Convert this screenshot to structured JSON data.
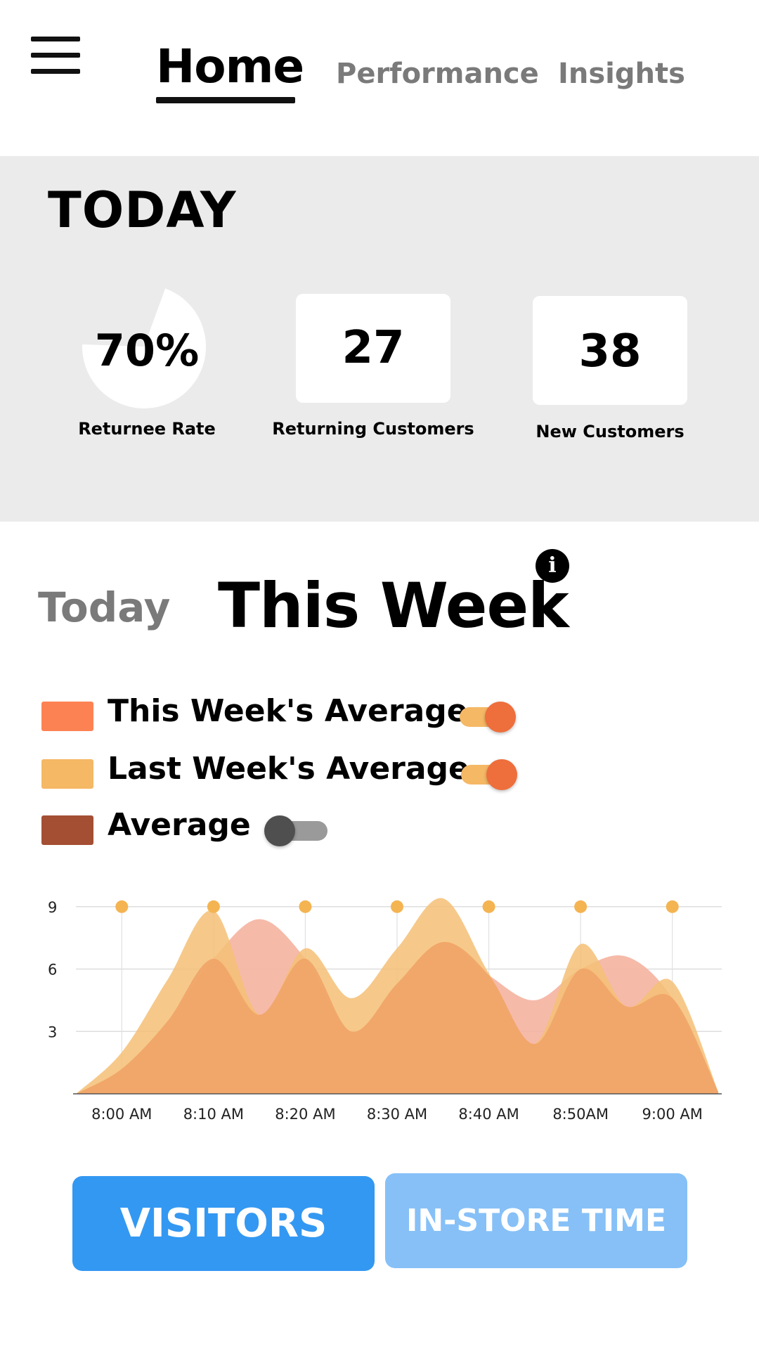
{
  "nav": {
    "tabs": [
      {
        "label": "Home",
        "active": true
      },
      {
        "label": "Performance",
        "active": false
      },
      {
        "label": "Insights",
        "active": false
      }
    ]
  },
  "today": {
    "title": "TODAY",
    "returnee_rate": {
      "value": "70%",
      "fraction": 0.7,
      "label": "Returnee Rate"
    },
    "returning_customers": {
      "value": "27",
      "label": "Returning Customers"
    },
    "new_customers": {
      "value": "38",
      "label": "New Customers"
    }
  },
  "period_tabs": {
    "today": "Today",
    "this_week": "This Week",
    "selected": "This Week"
  },
  "legend": [
    {
      "label": "This Week's Average",
      "color": "#fd8253",
      "toggle_on": true
    },
    {
      "label": "Last Week's Average",
      "color": "#f5b865",
      "toggle_on": true
    },
    {
      "label": "Average",
      "color": "#a44e33",
      "toggle_on": false
    }
  ],
  "colors": {
    "toggle_on_track": "#f5b865",
    "toggle_on_knob": "#ee6e3c",
    "toggle_off_track": "#9a9a9a",
    "toggle_off_knob": "#4f4f4f",
    "this_week_fill": "#f5b3a0",
    "last_week_fill": "#f5c075",
    "overlap_fill": "#f1a467",
    "marker": "#f4b452",
    "visitors_button": "#3398f2",
    "instore_button": "#86c0f7"
  },
  "chart_data": {
    "type": "area",
    "x": [
      "7:55 AM",
      "8:00 AM",
      "8:05 AM",
      "8:10 AM",
      "8:15 AM",
      "8:20 AM",
      "8:25 AM",
      "8:30 AM",
      "8:35 AM",
      "8:40 AM",
      "8:45 AM",
      "8:50AM",
      "8:55 AM",
      "9:00 AM",
      "9:05 AM"
    ],
    "series": [
      {
        "name": "This Week's Average",
        "values": [
          0,
          1.2,
          3.5,
          6.5,
          8.4,
          6.5,
          3.0,
          5.3,
          7.3,
          5.7,
          4.5,
          6.0,
          6.6,
          4.6,
          0.1
        ]
      },
      {
        "name": "Last Week's Average",
        "values": [
          0,
          2.0,
          5.5,
          8.8,
          3.8,
          7.0,
          4.6,
          7.0,
          9.4,
          5.8,
          2.4,
          7.2,
          4.2,
          5.4,
          0.1
        ]
      }
    ],
    "markers": {
      "x": [
        "8:00 AM",
        "8:10 AM",
        "8:20 AM",
        "8:30 AM",
        "8:40 AM",
        "8:50AM",
        "9:00 AM"
      ],
      "y": 9
    },
    "x_tick_labels": [
      "8:00 AM",
      "8:10 AM",
      "8:20 AM",
      "8:30 AM",
      "8:40 AM",
      "8:50AM",
      "9:00 AM"
    ],
    "y_ticks": [
      3,
      6,
      9
    ],
    "ylim": [
      0,
      9.5
    ],
    "grid": true
  },
  "buttons": {
    "visitors": "VISITORS",
    "in_store_time": "IN-STORE TIME"
  }
}
